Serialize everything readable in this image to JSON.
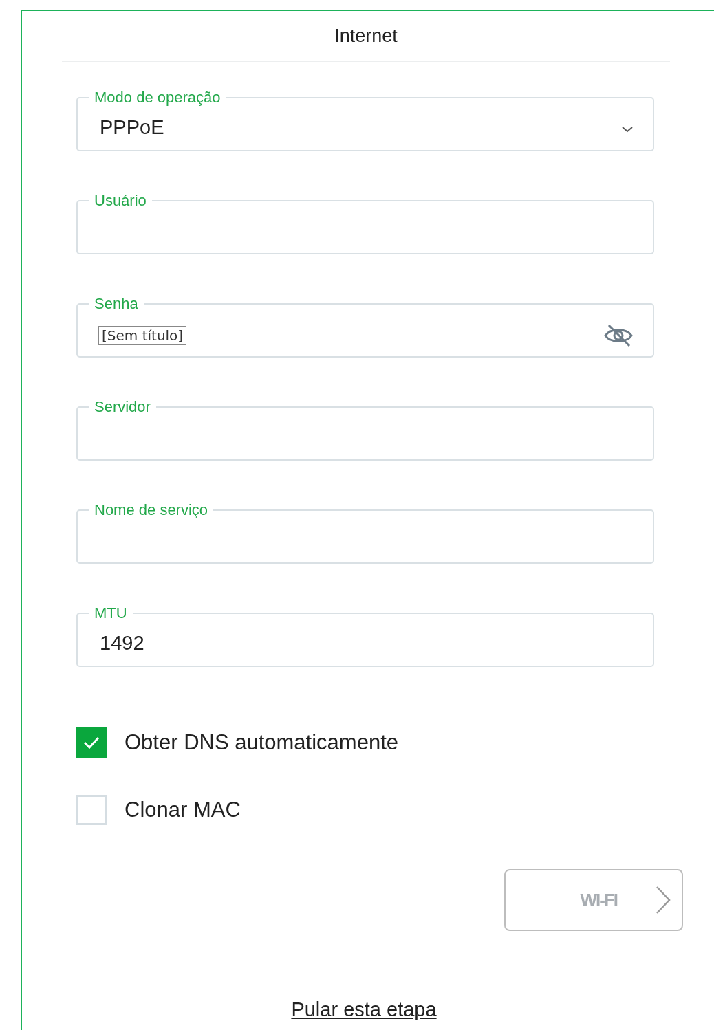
{
  "title": "Internet",
  "fields": [
    {
      "kind": "select",
      "label": "Modo de operação",
      "value": "PPPoE"
    },
    {
      "kind": "text",
      "label": "Usuário"
    },
    {
      "kind": "password",
      "label": "Senha",
      "tooltip": "[Sem título]"
    },
    {
      "kind": "text",
      "label": "Servidor"
    },
    {
      "kind": "text",
      "label": "Nome de serviço"
    },
    {
      "kind": "text",
      "label": "MTU",
      "value": "1492"
    }
  ],
  "checkboxes": [
    {
      "label": "Obter DNS automaticamente",
      "checked": true
    },
    {
      "label": "Clonar MAC",
      "checked": false
    }
  ],
  "next_button": {
    "label": "WI-FI",
    "disabled": true
  },
  "skip_link": "Pular esta etapa"
}
